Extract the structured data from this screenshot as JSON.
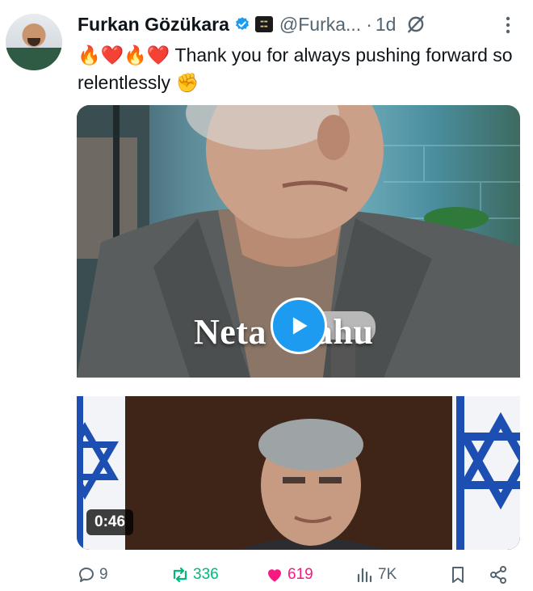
{
  "tweet": {
    "author_name": "Furkan Gözükara",
    "handle": "@Furka...",
    "separator": "·",
    "time": "1d",
    "text_emojis": "🔥❤️🔥❤️",
    "text": "Thank you for always pushing forward so relentlessly",
    "text_end_emoji": "✊"
  },
  "media": {
    "caption": "Netanyahu",
    "caption_visible_left": "Neta",
    "caption_visible_right": "ahu",
    "duration": "0:46"
  },
  "actions": {
    "replies": "9",
    "reposts": "336",
    "likes": "619",
    "views": "7K"
  },
  "colors": {
    "accent": "#1d9bf0",
    "repost": "#00ba7c",
    "like": "#f91880",
    "muted": "#536471"
  }
}
